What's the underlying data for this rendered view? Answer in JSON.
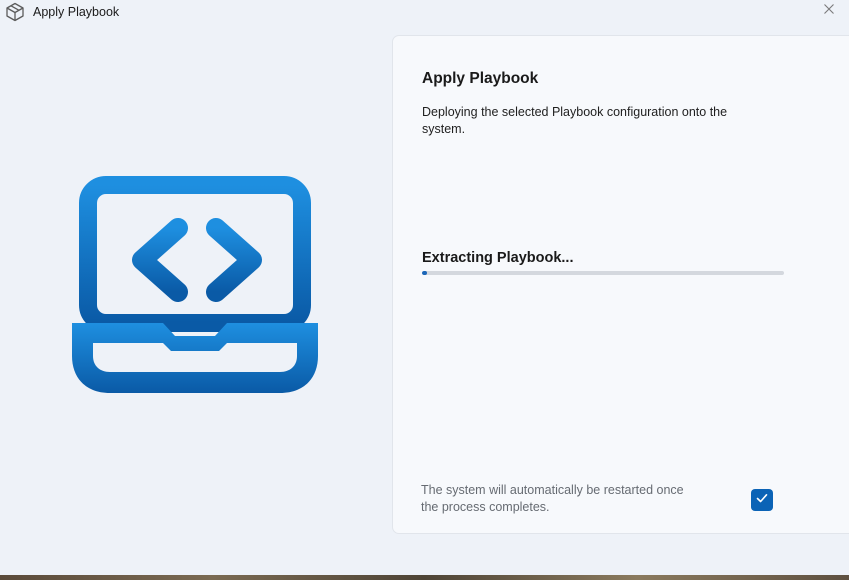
{
  "window": {
    "title": "Apply Playbook"
  },
  "icons": {
    "app": "playbook-logo-icon",
    "close": "close-icon",
    "hero": "laptop-code-icon",
    "check": "checkmark-icon"
  },
  "card": {
    "title": "Apply Playbook",
    "description": "Deploying the selected Playbook configuration onto the system.",
    "progress_label": "Extracting Playbook...",
    "progress": 0.015,
    "restart_text": "The system will automatically be restarted once the process completes.",
    "restart_checked": true
  },
  "colors": {
    "accent": "#0b63b6",
    "hero_top": "#1e8fe0",
    "hero_bottom": "#0a5aa6"
  }
}
